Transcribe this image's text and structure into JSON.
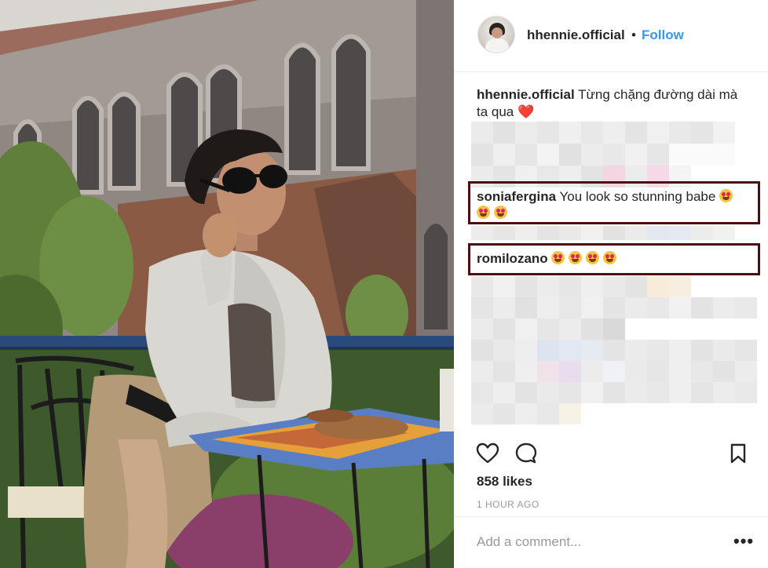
{
  "post": {
    "username": "hhennie.official",
    "dot": "•",
    "follow_label": "Follow",
    "caption_user": "hhennie.official",
    "caption_text": "Từng chặng đường dài mà ta qua",
    "caption_emoji": "❤️"
  },
  "comments": [
    {
      "user": "soniafergina",
      "text": "You look so stunning babe",
      "emoji_count": 3
    },
    {
      "user": "romilozano",
      "text": "",
      "emoji_count": 4
    }
  ],
  "actions": {
    "like_icon": "heart-outline-icon",
    "comment_icon": "speech-bubble-icon",
    "save_icon": "bookmark-icon"
  },
  "likes_label": "858 likes",
  "timestamp": "1 HOUR AGO",
  "add_comment": {
    "placeholder": "Add a comment...",
    "more_label": "•••"
  },
  "colors": {
    "link": "#3897f0",
    "highlight_border": "#4a1010",
    "muted": "#999999"
  }
}
